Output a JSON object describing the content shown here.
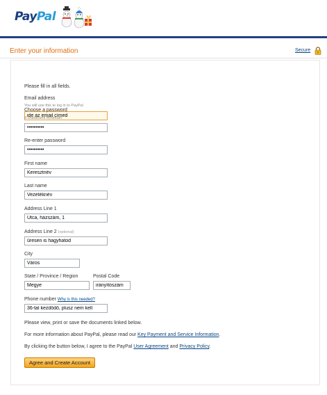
{
  "brand": {
    "part1": "Pay",
    "part2": "Pal"
  },
  "page": {
    "heading": "Enter your information",
    "secure_link": "Secure"
  },
  "intro": "Please fill in all fields.",
  "fields": {
    "email": {
      "label": "Email address",
      "hint": "You will use this to log in to PayPal",
      "value": "ide az email címed"
    },
    "password": {
      "label": "Choose a password",
      "hint": "8 characters minimum",
      "value": "••••••••••"
    },
    "reenter": {
      "label": "Re-enter password",
      "value": "••••••••••"
    },
    "first_name": {
      "label": "First name",
      "value": "Keresztnév"
    },
    "last_name": {
      "label": "Last name",
      "value": "Vezetéknév"
    },
    "address1": {
      "label": "Address Line 1",
      "value": "Utca, házszám, 1"
    },
    "address2": {
      "label": "Address Line 2",
      "optional": "(optional)",
      "value": "üresen is hagyhatod"
    },
    "city": {
      "label": "City",
      "value": "Város"
    },
    "state": {
      "label": "State / Province / Region",
      "value": "Megye"
    },
    "postal": {
      "label": "Postal Code",
      "value": "irányítószám"
    },
    "phone": {
      "label": "Phone number",
      "help_link": "Why is this needed?",
      "value": "36-tal kezdődő, plusz nem kell"
    }
  },
  "notes": {
    "view_docs": "Please view, print or save the documents linked below.",
    "more_info_prefix": "For more information about PayPal, please read our ",
    "key_info_link": "Key Payment and Service Information",
    "more_info_suffix": ".",
    "agree_prefix": "By clicking the button below, I agree to the PayPal ",
    "user_agreement_link": "User Agreement",
    "agree_mid": " and ",
    "privacy_link": "Privacy Policy",
    "agree_suffix": "."
  },
  "submit_label": "Agree and Create Account",
  "colors": {
    "brand_dark": "#1a3e7e",
    "brand_light": "#2a9bd6",
    "heading": "#e06d10",
    "link": "#084482",
    "button": "#f3a51c"
  },
  "icons": {
    "logo_decoration": "snowmen-icon",
    "secure": "lock-icon"
  }
}
